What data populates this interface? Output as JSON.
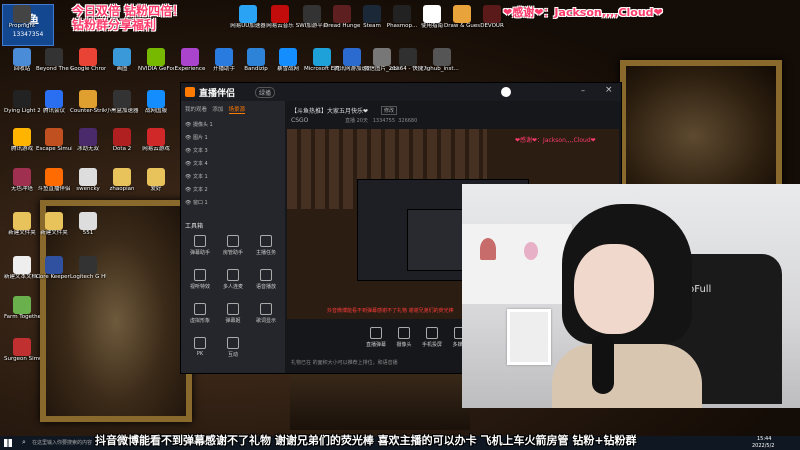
{
  "overlay": {
    "top_left_line1": "今日双倍 钻粉四倍！",
    "top_left_line2": "钻粉群分享福利",
    "thanks_banner": "❤感谢❤：Jackson,,,,Cloud❤",
    "badge_text": "斗鱼",
    "badge_number": "13347354",
    "ticker": "抖音微博能看不到弹幕感谢不了礼物 谢谢兄弟们的荧光棒 喜欢主播的可以办卡  飞机上车火箭房管 钻粉+钻粉群"
  },
  "desktop_icons": [
    {
      "label": "回收站",
      "color": "#4a8cd8"
    },
    {
      "label": "Beyond The Wire Sou...",
      "color": "#333"
    },
    {
      "label": "Google Chrome",
      "color": "#e94335"
    },
    {
      "label": "画图",
      "color": "#3a9ad9"
    },
    {
      "label": "NVIDIA GeForce",
      "color": "#76b900"
    },
    {
      "label": "Experience",
      "color": "#aa44cc"
    },
    {
      "label": "开播助手",
      "color": "#2a7be0"
    },
    {
      "label": "Bandizip",
      "color": "#2d83d8"
    },
    {
      "label": "暴雪战网",
      "color": "#148eff"
    },
    {
      "label": "Microsoft Edge",
      "color": "#1ea0d9"
    },
    {
      "label": "腾讯网游加速器",
      "color": "#2b6bd0"
    },
    {
      "label": "微信图片_2021111...",
      "color": "#777"
    },
    {
      "label": "obs64 - 快捷方式",
      "color": "#303030"
    },
    {
      "label": "ighub_inst...",
      "color": "#555"
    },
    {
      "label": "网易UU加速器",
      "color": "#2aa3f4"
    },
    {
      "label": "网易云音乐",
      "color": "#c20c0c"
    },
    {
      "label": "SWI加游平台",
      "color": "#333"
    },
    {
      "label": "Dread Hunger",
      "color": "#5d1f1f"
    },
    {
      "label": "Steam",
      "color": "#1b2838"
    },
    {
      "label": "Phasmop...",
      "color": "#222"
    },
    {
      "label": "使用指南",
      "color": "#fff"
    },
    {
      "label": "Draw & Guess",
      "color": "#e8a33b"
    },
    {
      "label": "DEVOUR",
      "color": "#5a1a1a"
    },
    {
      "label": "Propnight",
      "color": "#444"
    },
    {
      "label": "Dying Light 2",
      "color": "#222"
    },
    {
      "label": "腾讯会议",
      "color": "#2a6ff2"
    },
    {
      "label": "Counter-Strike: Global Off...",
      "color": "#e0a030"
    },
    {
      "label": "小黑盒加速器",
      "color": "#333"
    },
    {
      "label": "战网国服",
      "color": "#148eff"
    },
    {
      "label": "腾讯游戏",
      "color": "#ffb400"
    },
    {
      "label": "Escape Simulator",
      "color": "#c05020"
    },
    {
      "label": "冰劫无双",
      "color": "#4a2a6a"
    },
    {
      "label": "Dota 2",
      "color": "#b02020"
    },
    {
      "label": "网易云游戏",
      "color": "#d02828"
    },
    {
      "label": "无色冲塔",
      "color": "#a03050"
    },
    {
      "label": "斗鱼直播伴侣",
      "color": "#ff6b00"
    },
    {
      "label": "swencky",
      "color": "#ddd"
    },
    {
      "label": "zhaopian",
      "color": "#e8c25a"
    },
    {
      "label": "爱好",
      "color": "#e8c25a"
    },
    {
      "label": "新建文件夹",
      "color": "#e8c25a"
    },
    {
      "label": "新建文件夹",
      "color": "#e8c25a"
    },
    {
      "label": "551",
      "color": "#ddd"
    },
    {
      "label": "新建文本文档 (3)",
      "color": "#eee"
    },
    {
      "label": "Farm Together",
      "color": "#6ab04c"
    },
    {
      "label": "Surgeon Simulator",
      "color": "#c03030"
    },
    {
      "label": "Core Keeper 测试",
      "color": "#3050a0"
    },
    {
      "label": "Logitech G HUB",
      "color": "#333"
    }
  ],
  "app": {
    "logo": "直播伴侣",
    "tab_label": "绿播",
    "sidebar_tabs": [
      "我的观看",
      "添加",
      "场景源"
    ],
    "scene_items": [
      "摄像头 1",
      "图片 1",
      "文本 3",
      "文本 4",
      "文本 1",
      "文本 2",
      "窗口 1"
    ],
    "tools_title": "工具箱",
    "tools": [
      "弹幕助手",
      "房管助手",
      "主播任务",
      "视听特效",
      "多人连麦",
      "语音播放",
      "虚拟形象",
      "弹幕姬",
      "歌词显示",
      "PK",
      "互动"
    ],
    "room_title": "【斗鱼热推】大家五月快乐❤",
    "room_tag": "修改",
    "category": "CSGO",
    "stats": [
      "直播 20天 ",
      "1334755",
      "326680"
    ],
    "bottom_buttons": [
      "直播弹幕",
      "摄像头",
      "手机投屏",
      "多媒体"
    ],
    "bottom_tip": "礼物已在 的面积大小可以推荐上排位，和语音播",
    "red_overlay": "抖音微博能看不到弹幕感谢不了礼物 谢谢兄弟们的荧光棒"
  },
  "taskbar": {
    "search_placeholder": "在这里输入你要搜索的内容",
    "time": "15:44",
    "date": "2022/5/2"
  },
  "camera": {
    "chair_brand": "ooFull"
  }
}
